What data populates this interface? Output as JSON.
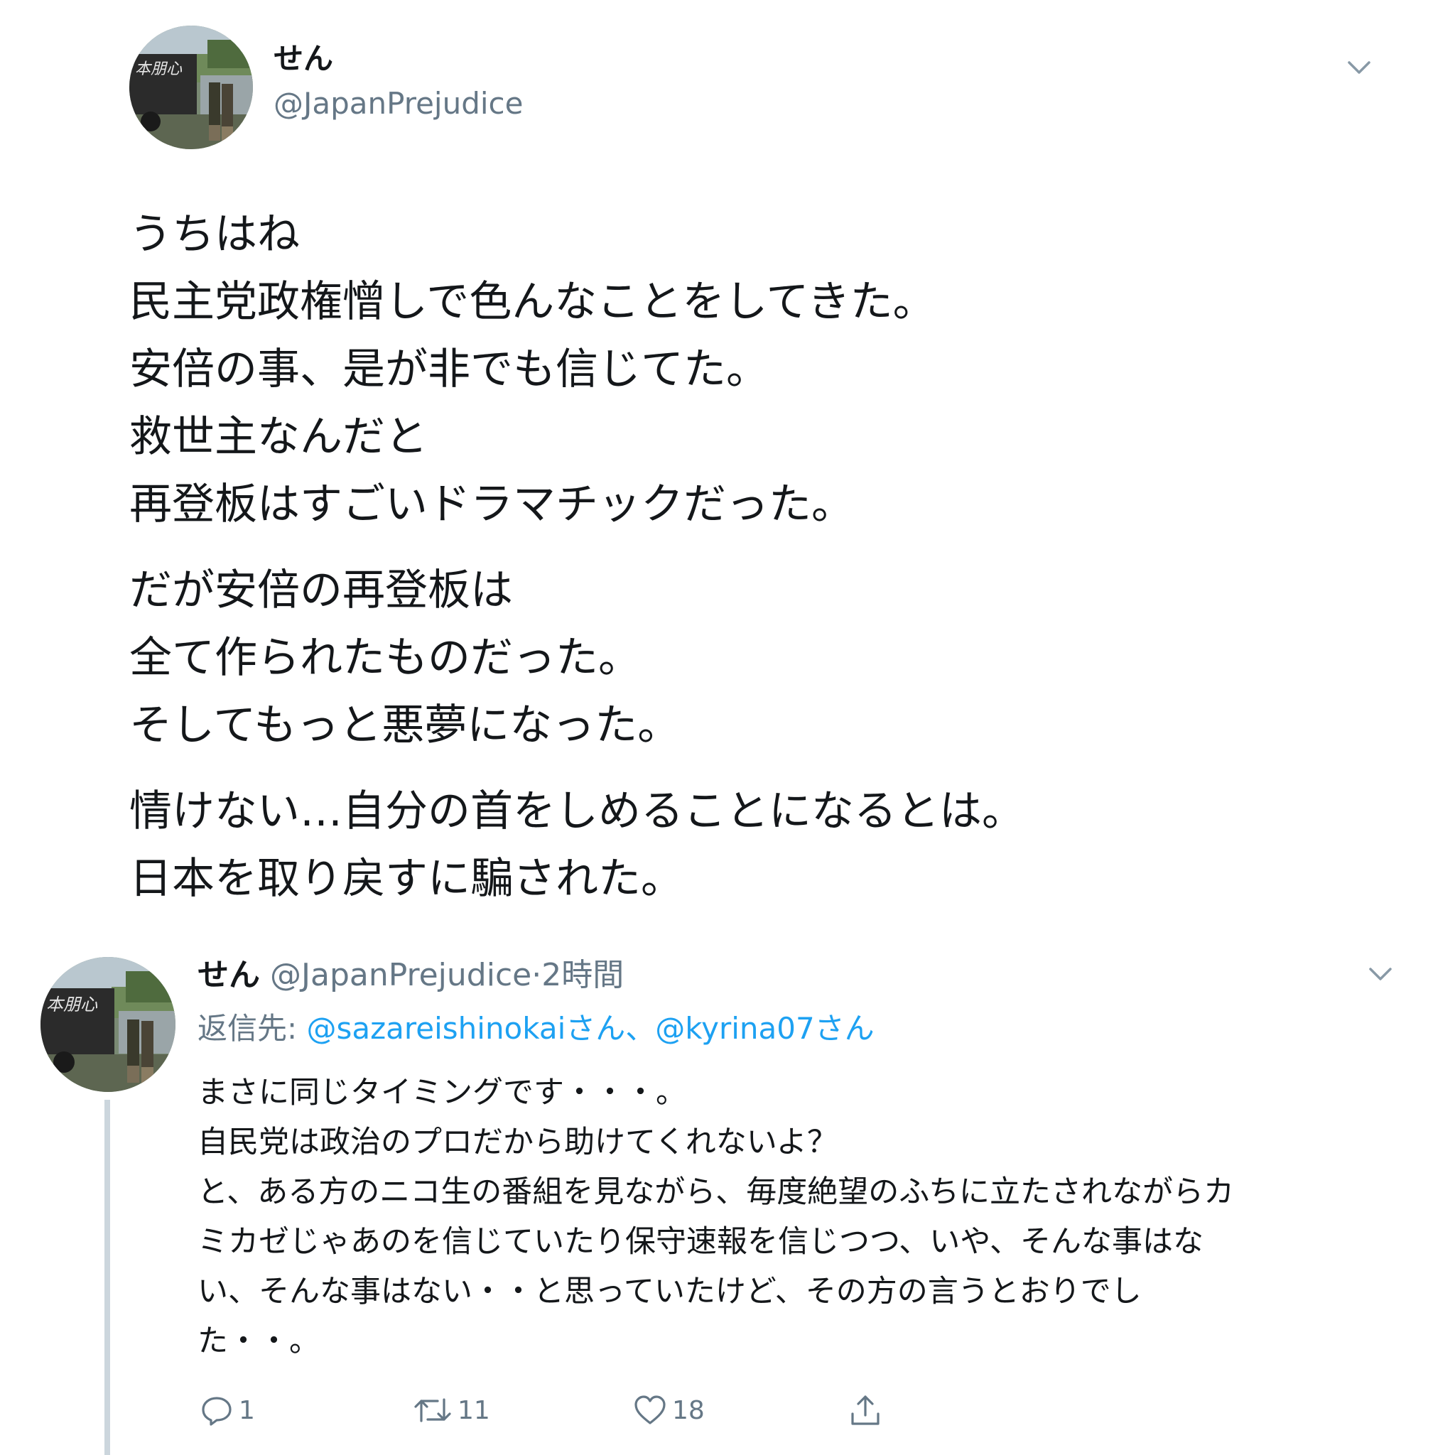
{
  "main_tweet": {
    "author_name": "せん",
    "author_handle": "@JapanPrejudice",
    "paragraphs": [
      [
        "うちはね",
        "民主党政権憎しで色んなことをしてきた。",
        "安倍の事、是が非でも信じてた。",
        "救世主なんだと",
        "再登板はすごいドラマチックだった。"
      ],
      [
        "だが安倍の再登板は",
        "全て作られたものだった。",
        "そしてもっと悪夢になった。"
      ],
      [
        "情けない…自分の首をしめることになるとは。",
        "日本を取り戻すに騙された。"
      ]
    ],
    "icons": {
      "avatar": "profile-photo",
      "caret": "chevron-down-icon"
    }
  },
  "reply_tweet": {
    "author_name": "せん",
    "author_handle": "@JapanPrejudice",
    "separator": "·",
    "time": "2時間",
    "reply_to_label": "返信先:",
    "reply_to_mentions": [
      "@sazareishinokaiさん",
      "@kyrina07さん"
    ],
    "reply_to_separator": "、",
    "lines": [
      "まさに同じタイミングです・・・。",
      "自民党は政治のプロだから助けてくれないよ？",
      "と、ある方のニコ生の番組を見ながら、毎度絶望のふちに立たされながらカ",
      "ミカゼじゃあのを信じていたり保守速報を信じつつ、いや、そんな事はな",
      "い、そんな事はない・・と思っていたけど、その方の言うとおりでし",
      "た・・。"
    ],
    "actions": {
      "reply_count": "1",
      "retweet_count": "11",
      "like_count": "18"
    },
    "icons": {
      "reply": "reply-icon",
      "retweet": "retweet-icon",
      "like": "heart-icon",
      "share": "share-icon",
      "caret": "chevron-down-icon"
    }
  },
  "colors": {
    "text": "#14171a",
    "secondary_text": "#657786",
    "link": "#1da1f2",
    "thread_line": "#ccd6dd",
    "background": "#ffffff"
  }
}
